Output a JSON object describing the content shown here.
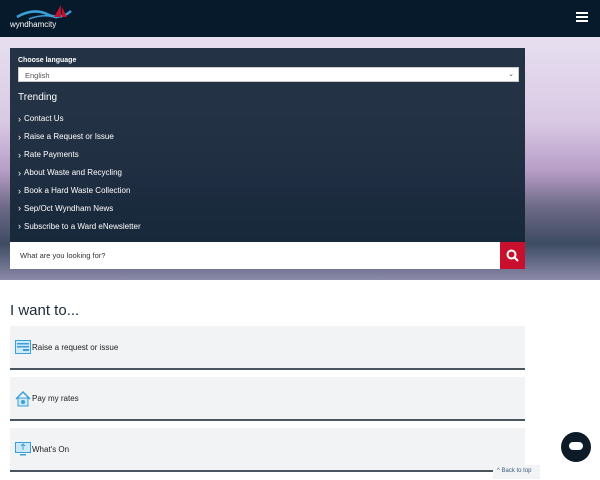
{
  "header": {
    "logo_text": "wyndhamcity"
  },
  "panel": {
    "language_label": "Choose language",
    "language_value": "English",
    "trending_title": "Trending",
    "trending": [
      "Contact Us",
      "Raise a Request or Issue",
      "Rate Payments",
      "About Waste and Recycling",
      "Book a Hard Waste Collection",
      "Sep/Oct Wyndham News",
      "Subscribe to a Ward eNewsletter"
    ]
  },
  "search": {
    "placeholder": "What are you looking for?"
  },
  "main": {
    "title": "I want to...",
    "cards": [
      "Raise a request or issue",
      "Pay my rates",
      "What's On"
    ]
  },
  "back_to_top": "Back to top",
  "colors": {
    "header": "#071a2c",
    "accent": "#c8102e",
    "icon": "#3aa0d8"
  }
}
